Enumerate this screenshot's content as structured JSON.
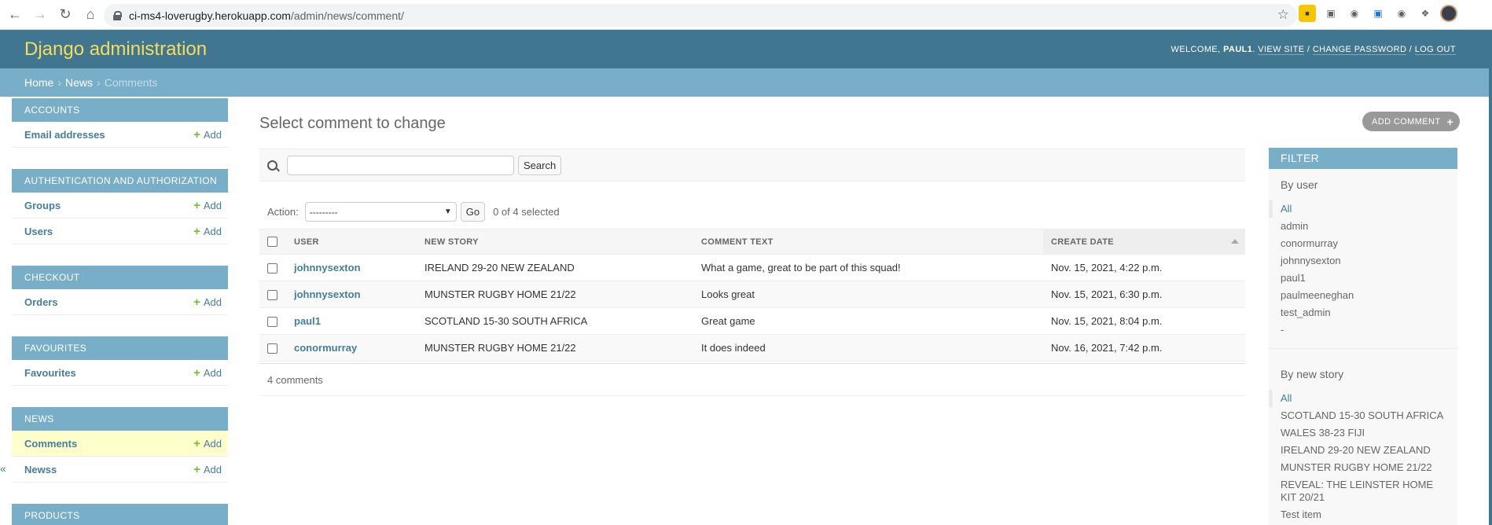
{
  "browser": {
    "url_host": "ci-ms4-loverugby.herokuapp.com",
    "url_path": "/admin/news/comment/"
  },
  "header": {
    "branding": "Django administration",
    "welcome": "WELCOME,",
    "username": "PAUL1",
    "view_site": "VIEW SITE",
    "change_password": "CHANGE PASSWORD",
    "log_out": "LOG OUT"
  },
  "breadcrumbs": {
    "home": "Home",
    "app": "News",
    "current": "Comments"
  },
  "sidebar": {
    "add_label": "Add",
    "modules": [
      {
        "title": "ACCOUNTS",
        "items": [
          {
            "label": "Email addresses"
          }
        ]
      },
      {
        "title": "AUTHENTICATION AND AUTHORIZATION",
        "items": [
          {
            "label": "Groups"
          },
          {
            "label": "Users"
          }
        ]
      },
      {
        "title": "CHECKOUT",
        "items": [
          {
            "label": "Orders"
          }
        ]
      },
      {
        "title": "FAVOURITES",
        "items": [
          {
            "label": "Favourites"
          }
        ]
      },
      {
        "title": "NEWS",
        "items": [
          {
            "label": "Comments"
          },
          {
            "label": "Newss"
          }
        ]
      },
      {
        "title": "PRODUCTS",
        "items": []
      }
    ]
  },
  "content": {
    "title": "Select comment to change",
    "add_button": "ADD COMMENT",
    "search": {
      "value": "",
      "button": "Search"
    },
    "actions": {
      "label": "Action:",
      "selected": "---------",
      "go": "Go",
      "count": "0 of 4 selected"
    },
    "table": {
      "headers": {
        "user": "USER",
        "story": "NEW STORY",
        "comment": "COMMENT TEXT",
        "date": "CREATE DATE"
      },
      "rows": [
        {
          "user": "johnnysexton",
          "story": "IRELAND 29-20 NEW ZEALAND",
          "comment": "What a game, great to be part of this squad!",
          "date": "Nov. 15, 2021, 4:22 p.m."
        },
        {
          "user": "johnnysexton",
          "story": "MUNSTER RUGBY HOME 21/22",
          "comment": "Looks great",
          "date": "Nov. 15, 2021, 6:30 p.m."
        },
        {
          "user": "paul1",
          "story": "SCOTLAND 15-30 SOUTH AFRICA",
          "comment": "Great game",
          "date": "Nov. 15, 2021, 8:04 p.m."
        },
        {
          "user": "conormurray",
          "story": "MUNSTER RUGBY HOME 21/22",
          "comment": "It does indeed",
          "date": "Nov. 16, 2021, 7:42 p.m."
        }
      ]
    },
    "paginator": "4 comments"
  },
  "filter": {
    "title": "FILTER",
    "by_user": {
      "title": "By user",
      "options": [
        "All",
        "admin",
        "conormurray",
        "johnnysexton",
        "paul1",
        "paulmeeneghan",
        "test_admin",
        "-"
      ]
    },
    "by_story": {
      "title": "By new story",
      "options": [
        "All",
        "SCOTLAND 15-30 SOUTH AFRICA",
        "WALES 38-23 FIJI",
        "IRELAND 29-20 NEW ZEALAND",
        "MUNSTER RUGBY HOME 21/22",
        "REVEAL: THE LEINSTER HOME KIT 20/21",
        "Test item"
      ]
    }
  }
}
